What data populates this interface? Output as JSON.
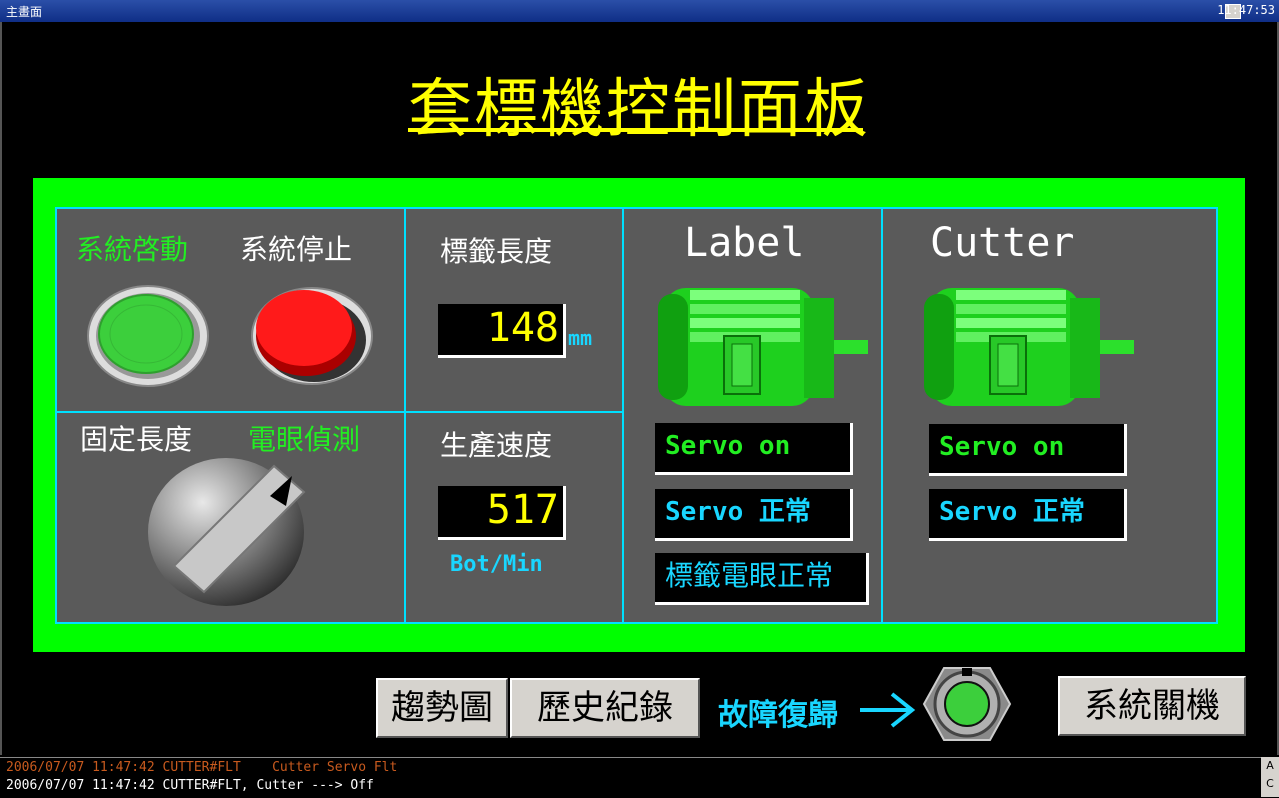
{
  "window": {
    "title": "主畫面",
    "clock": "11:47:53"
  },
  "page_title": "套標機控制面板",
  "system": {
    "start_label": "系統啓動",
    "stop_label": "系統停止",
    "fixed_length_label": "固定長度",
    "photo_eye_label": "電眼偵測"
  },
  "length": {
    "label": "標籤長度",
    "value": "148",
    "unit": "mm"
  },
  "speed": {
    "label": "生產速度",
    "value": "517",
    "unit": "Bot/Min"
  },
  "label_motor": {
    "name": "Label",
    "statuses": [
      "Servo on",
      "Servo 正常",
      "標籤電眼正常"
    ]
  },
  "cutter_motor": {
    "name": "Cutter",
    "statuses": [
      "Servo on",
      "Servo 正常"
    ]
  },
  "footer": {
    "trend_button": "趨勢圖",
    "history_button": "歷史紀錄",
    "fault_reset_label": "故障復歸",
    "shutdown_button": "系統關機"
  },
  "messages": [
    "2006/07/07 11:47:42 CUTTER#FLT    Cutter Servo Flt",
    "2006/07/07 11:47:42 CUTTER#FLT, Cutter ---> Off"
  ],
  "colors": {
    "accent": "#00ff00",
    "title": "#ffff00",
    "panel": "#5a5a5a",
    "border": "#00e0ff",
    "msg_alarm": "#c85a1e",
    "msg_normal": "#ffffff"
  }
}
